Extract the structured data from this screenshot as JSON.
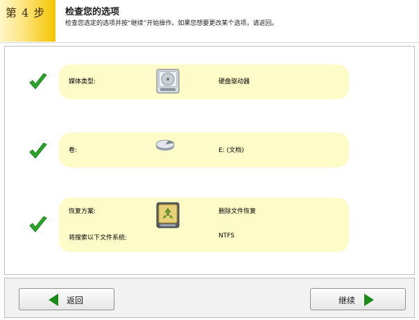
{
  "header": {
    "step_label": "第 4 步",
    "title": "检查您的选项",
    "subtitle": "检查您选定的选项并按“继续”开始操作。如果您想要更改某个选项，请返回。"
  },
  "rows": [
    {
      "label": "媒体类型:",
      "value": "硬盘驱动器",
      "icon": "hard-drive-icon"
    },
    {
      "label": "卷:",
      "value": "E: (文档)",
      "icon": "volume-icon"
    },
    {
      "label": "恢复方案:",
      "value": "删除文件恢复",
      "label2": "将搜索以下文件系统:",
      "value2": "NTFS",
      "icon": "recycle-drive-icon"
    }
  ],
  "footer": {
    "back_label": "返回",
    "next_label": "继续"
  },
  "colors": {
    "accent_yellow": "#f5c400",
    "panel_bg": "#fdfbc8",
    "check_green": "#2aa52a",
    "arrow_green": "#1a8a1a"
  }
}
